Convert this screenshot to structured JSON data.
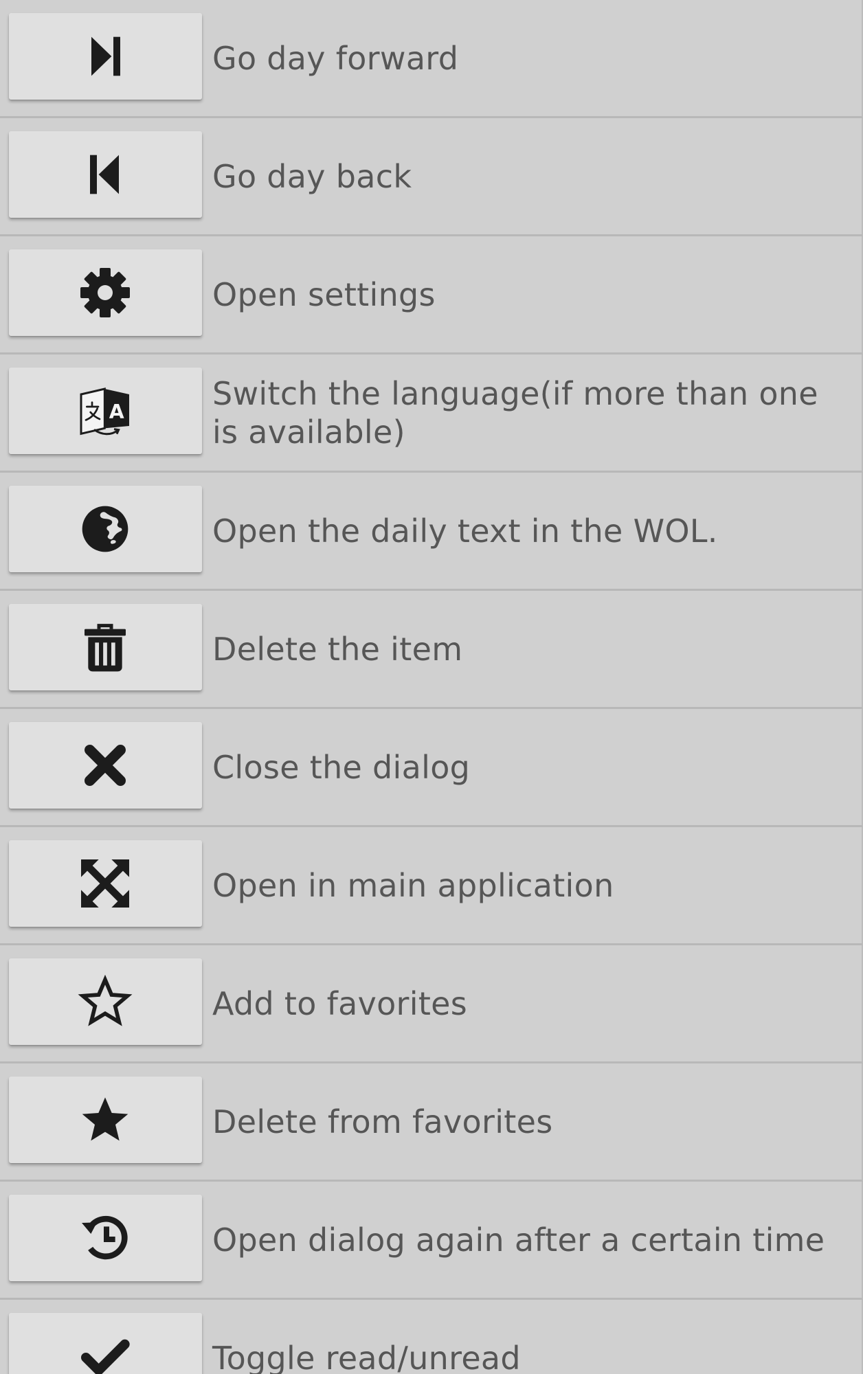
{
  "colors": {
    "background": "#d2d2d2",
    "button": "#e0e0e0",
    "icon": "#1c1c1c",
    "text": "#565656",
    "divider": "#b8b8b8"
  },
  "legend": [
    {
      "icon": "skip-forward-icon",
      "label": "Go day forward"
    },
    {
      "icon": "skip-back-icon",
      "label": "Go day back"
    },
    {
      "icon": "gear-icon",
      "label": "Open settings"
    },
    {
      "icon": "translate-icon",
      "label": "Switch the language(if more than one is available)"
    },
    {
      "icon": "globe-icon",
      "label": "Open the daily text in the WOL."
    },
    {
      "icon": "trash-icon",
      "label": "Delete the item"
    },
    {
      "icon": "close-icon",
      "label": "Close the dialog"
    },
    {
      "icon": "expand-icon",
      "label": "Open in main application"
    },
    {
      "icon": "star-outline-icon",
      "label": "Add to favorites"
    },
    {
      "icon": "star-filled-icon",
      "label": "Delete from favorites"
    },
    {
      "icon": "history-icon",
      "label": "Open dialog again after a certain time"
    },
    {
      "icon": "check-icon",
      "label": "Toggle read/unread"
    }
  ]
}
